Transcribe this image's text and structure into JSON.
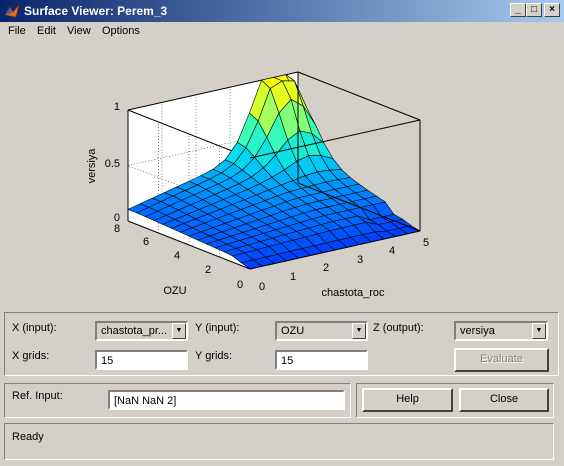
{
  "window": {
    "title": "Surface Viewer: Perem_3",
    "min_glyph": "_",
    "max_glyph": "□",
    "close_glyph": "×"
  },
  "menu": {
    "items": [
      "File",
      "Edit",
      "View",
      "Options"
    ]
  },
  "plot": {
    "zlabel": "versiya",
    "xlabel": "chastota_roc",
    "ylabel": "OZU",
    "z_ticks": [
      "0",
      "0.5",
      "1"
    ],
    "x_ticks": [
      "0",
      "1",
      "2",
      "3",
      "4",
      "5"
    ],
    "y_ticks": [
      "0",
      "2",
      "4",
      "6",
      "8"
    ]
  },
  "chart_data": {
    "type": "surface",
    "x": [
      0,
      5
    ],
    "y": [
      0,
      8
    ],
    "zlim": [
      0,
      1
    ],
    "xlabel": "chastota_roc",
    "ylabel": "OZU",
    "zlabel": "versiya",
    "grid": true,
    "note": "15x15 surface grid; peak near x=5, y=8 reaching z~1"
  },
  "controls": {
    "x_input_label": "X (input):",
    "x_input_value": "chastota_pr...",
    "y_input_label": "Y (input):",
    "y_input_value": "OZU",
    "z_output_label": "Z (output):",
    "z_output_value": "versiya",
    "x_grids_label": "X grids:",
    "x_grids_value": "15",
    "y_grids_label": "Y grids:",
    "y_grids_value": "15",
    "evaluate_label": "Evaluate",
    "ref_input_label": "Ref. Input:",
    "ref_input_value": "[NaN NaN 2]",
    "help_label": "Help",
    "close_label": "Close",
    "status": "Ready"
  },
  "colors": {
    "title_start": "#0a246a",
    "title_end": "#a6caf0",
    "face": "#d4d0c8"
  }
}
